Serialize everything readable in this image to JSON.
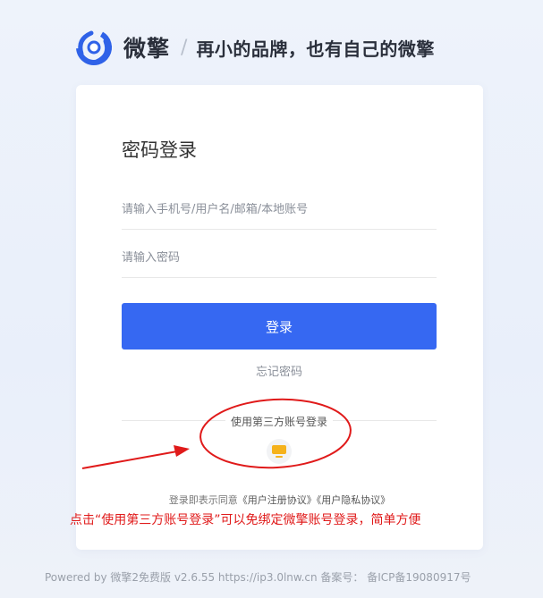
{
  "header": {
    "logo_icon": "weiqing-swirl-logo",
    "brand_name": "微擎",
    "separator": "/",
    "slogan": "再小的品牌，也有自己的微擎"
  },
  "login": {
    "title": "密码登录",
    "username_placeholder": "请输入手机号/用户名/邮箱/本地账号",
    "password_placeholder": "请输入密码",
    "login_button": "登录",
    "forgot_password": "忘记密码",
    "third_party_title": "使用第三方账号登录",
    "third_party_icon": "monitor-icon",
    "agreement_prefix": "登录即表示同意",
    "agreement_terms": "《用户注册协议》",
    "agreement_privacy": "《用户隐私协议》"
  },
  "annotation": {
    "note": "点击“使用第三方账号登录”可以免绑定微擎账号登录，简单方便",
    "color": "#e01a1a"
  },
  "footer": {
    "text": "Powered by 微擎2免费版 v2.6.55  https://ip3.0lnw.cn  备案号：  备ICP备19080917号"
  },
  "colors": {
    "primary": "#3668f2",
    "logo_blue": "#2f62e8",
    "third_icon": "#f5b21c"
  }
}
